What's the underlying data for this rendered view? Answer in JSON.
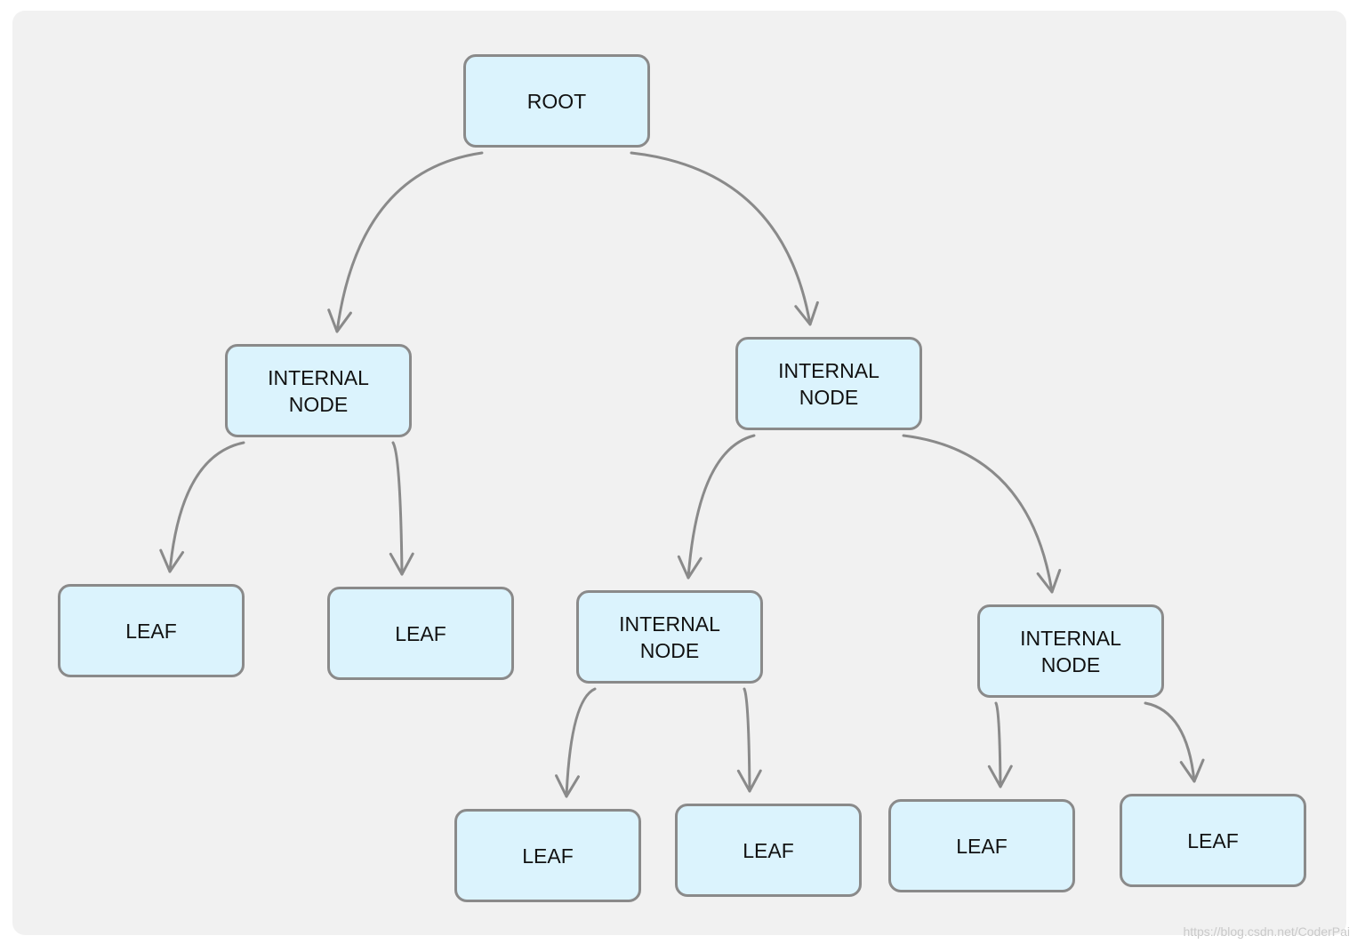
{
  "diagram": {
    "type": "tree",
    "colors": {
      "canvas": "#f1f1f1",
      "node_fill": "#dbf3fd",
      "node_border": "#8a8a8a",
      "edge": "#8a8a8a",
      "text": "#111111"
    },
    "nodes": [
      {
        "id": "root",
        "label": "ROOT",
        "kind": "root"
      },
      {
        "id": "in1",
        "label": "INTERNAL\nNODE",
        "kind": "internal"
      },
      {
        "id": "in2",
        "label": "INTERNAL\nNODE",
        "kind": "internal"
      },
      {
        "id": "leaf1",
        "label": "LEAF",
        "kind": "leaf"
      },
      {
        "id": "leaf2",
        "label": "LEAF",
        "kind": "leaf"
      },
      {
        "id": "in3",
        "label": "INTERNAL\nNODE",
        "kind": "internal"
      },
      {
        "id": "in4",
        "label": "INTERNAL\nNODE",
        "kind": "internal"
      },
      {
        "id": "leaf3",
        "label": "LEAF",
        "kind": "leaf"
      },
      {
        "id": "leaf4",
        "label": "LEAF",
        "kind": "leaf"
      },
      {
        "id": "leaf5",
        "label": "LEAF",
        "kind": "leaf"
      },
      {
        "id": "leaf6",
        "label": "LEAF",
        "kind": "leaf"
      }
    ],
    "edges": [
      {
        "from": "root",
        "to": "in1"
      },
      {
        "from": "root",
        "to": "in2"
      },
      {
        "from": "in1",
        "to": "leaf1"
      },
      {
        "from": "in1",
        "to": "leaf2"
      },
      {
        "from": "in2",
        "to": "in3"
      },
      {
        "from": "in2",
        "to": "in4"
      },
      {
        "from": "in3",
        "to": "leaf3"
      },
      {
        "from": "in3",
        "to": "leaf4"
      },
      {
        "from": "in4",
        "to": "leaf5"
      },
      {
        "from": "in4",
        "to": "leaf6"
      }
    ]
  },
  "watermark": "https://blog.csdn.net/CoderPai"
}
